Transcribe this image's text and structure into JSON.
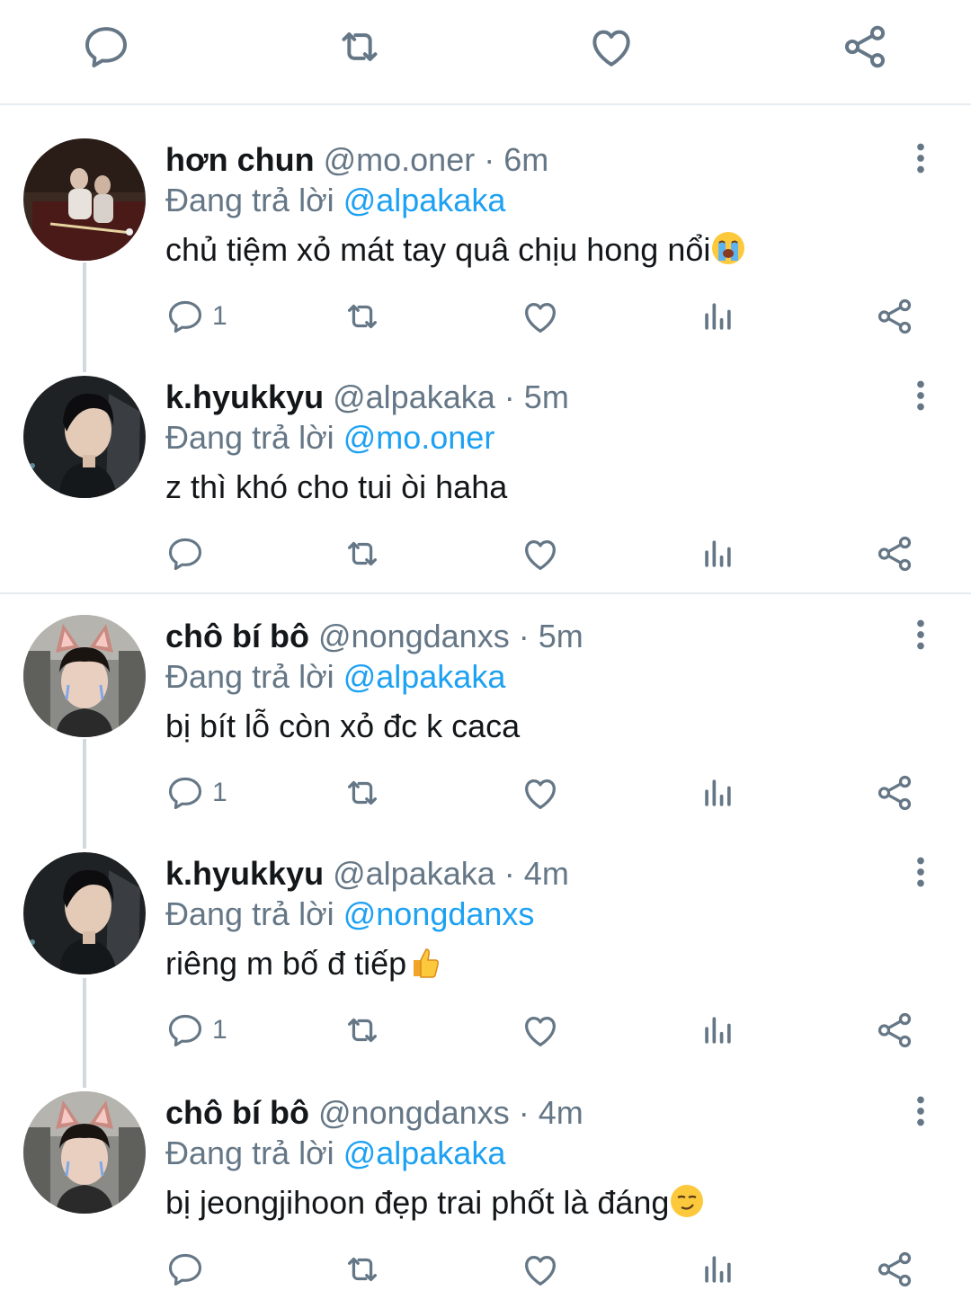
{
  "reply_prefix": "Đang trả lời",
  "colors": {
    "accent": "#1da1f2",
    "icon": "#657786",
    "muted": "#657786",
    "divider": "#e6ecf0"
  },
  "top_actions": [
    "reply-icon",
    "retweet-icon",
    "like-icon",
    "share-icon"
  ],
  "tweets": [
    {
      "name": "hơn chun",
      "handle": "@mo.oner",
      "sep": "·",
      "time": "6m",
      "reply_to": "@alpakaka",
      "text": "chủ tiệm xỏ mát tay quâ chịu hong nổi",
      "emoji": "loudly-crying-face",
      "reply_count": "1"
    },
    {
      "name": "k.hyukkyu",
      "handle": "@alpakaka",
      "sep": "·",
      "time": "5m",
      "reply_to": "@mo.oner",
      "text": "z thì khó cho tui òi haha",
      "emoji": "",
      "reply_count": ""
    },
    {
      "name": "chô bí bô",
      "handle": "@nongdanxs",
      "sep": "·",
      "time": "5m",
      "reply_to": "@alpakaka",
      "text": "bị bít lỗ còn xỏ đc k caca",
      "emoji": "",
      "reply_count": "1"
    },
    {
      "name": "k.hyukkyu",
      "handle": "@alpakaka",
      "sep": "·",
      "time": "4m",
      "reply_to": "@nongdanxs",
      "text": "riêng m bố đ tiếp",
      "emoji": "thumbs-up",
      "reply_count": "1"
    },
    {
      "name": "chô bí bô",
      "handle": "@nongdanxs",
      "sep": "·",
      "time": "4m",
      "reply_to": "@alpakaka",
      "text": "bị jeongjihoon đẹp trai phốt là đáng",
      "emoji": "smirking-face",
      "reply_count": ""
    }
  ]
}
